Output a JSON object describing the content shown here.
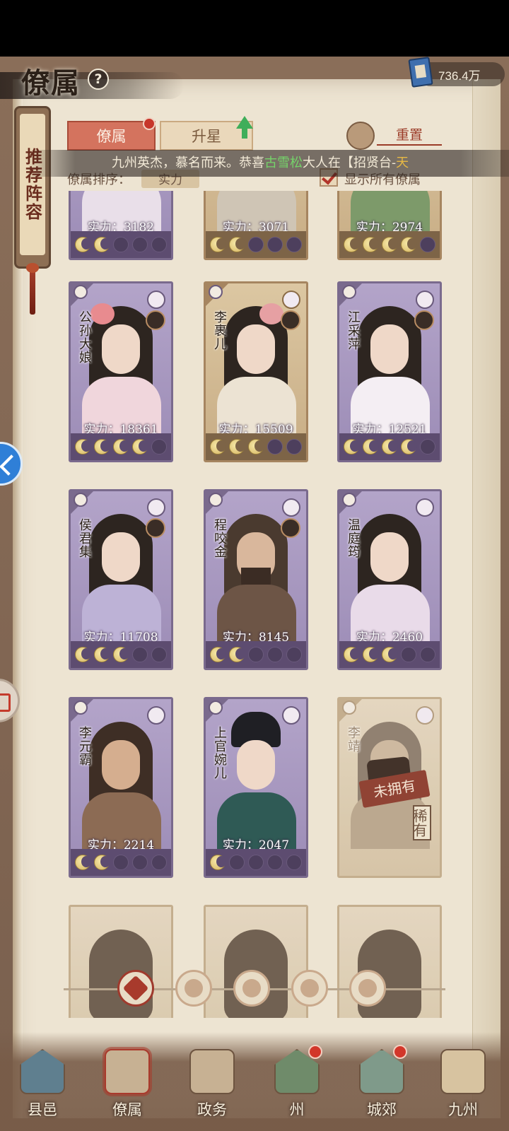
{
  "header": {
    "title": "僚属",
    "help": "?",
    "currency_value": "736.4万"
  },
  "side_tag": {
    "label": "推荐阵容"
  },
  "tabs": [
    {
      "label": "僚属",
      "active": true
    },
    {
      "label": "升星",
      "active": false
    }
  ],
  "reset_label": "重置",
  "notice": {
    "prefix": "九州英杰，慕名而来。恭喜",
    "player": "古雪松",
    "middle": "大人在【招贤台-",
    "tail": "天"
  },
  "sort": {
    "label": "僚属排序：",
    "value": "实力"
  },
  "show_all": {
    "label": "显示所有僚属",
    "checked": true
  },
  "cards_row0": [
    {
      "power": "实力：3182"
    },
    {
      "power": "实力：3071"
    },
    {
      "power": "实力：2974"
    }
  ],
  "cards": [
    {
      "name": "公孙大娘",
      "power": "实力：18361",
      "stars": 4,
      "theme": "purple"
    },
    {
      "name": "李裹儿",
      "power": "实力：15509",
      "stars": 3,
      "theme": "gold"
    },
    {
      "name": "江采萍",
      "power": "实力：12521",
      "stars": 4,
      "theme": "purple"
    },
    {
      "name": "侯君集",
      "power": "实力：11708",
      "stars": 3,
      "theme": "purple"
    },
    {
      "name": "程咬金",
      "power": "实力：8145",
      "stars": 2,
      "theme": "purple"
    },
    {
      "name": "温庭筠",
      "power": "实力：2460",
      "stars": 3,
      "theme": "purple"
    },
    {
      "name": "李元霸",
      "power": "实力：2214",
      "stars": 2,
      "theme": "purple"
    },
    {
      "name": "上官婉儿",
      "power": "实力：2047",
      "stars": 1,
      "theme": "purple"
    },
    {
      "name": "李靖",
      "power": "",
      "stars": 0,
      "theme": "dim",
      "unowned": "未拥有",
      "rarity": "稀有"
    }
  ],
  "bottom_nav": [
    {
      "label": "县邑",
      "badge": false,
      "active": false
    },
    {
      "label": "僚属",
      "badge": false,
      "active": true
    },
    {
      "label": "政务",
      "badge": false,
      "active": false
    },
    {
      "label": "州",
      "badge": true,
      "active": false
    },
    {
      "label": "城郊",
      "badge": true,
      "active": false
    },
    {
      "label": "九州",
      "badge": false,
      "active": false
    }
  ],
  "colors": {
    "accent_red": "#d4735e",
    "card_purple": "#9c8cb6",
    "card_gold": "#c8ad85",
    "paper": "#ede4d2"
  }
}
